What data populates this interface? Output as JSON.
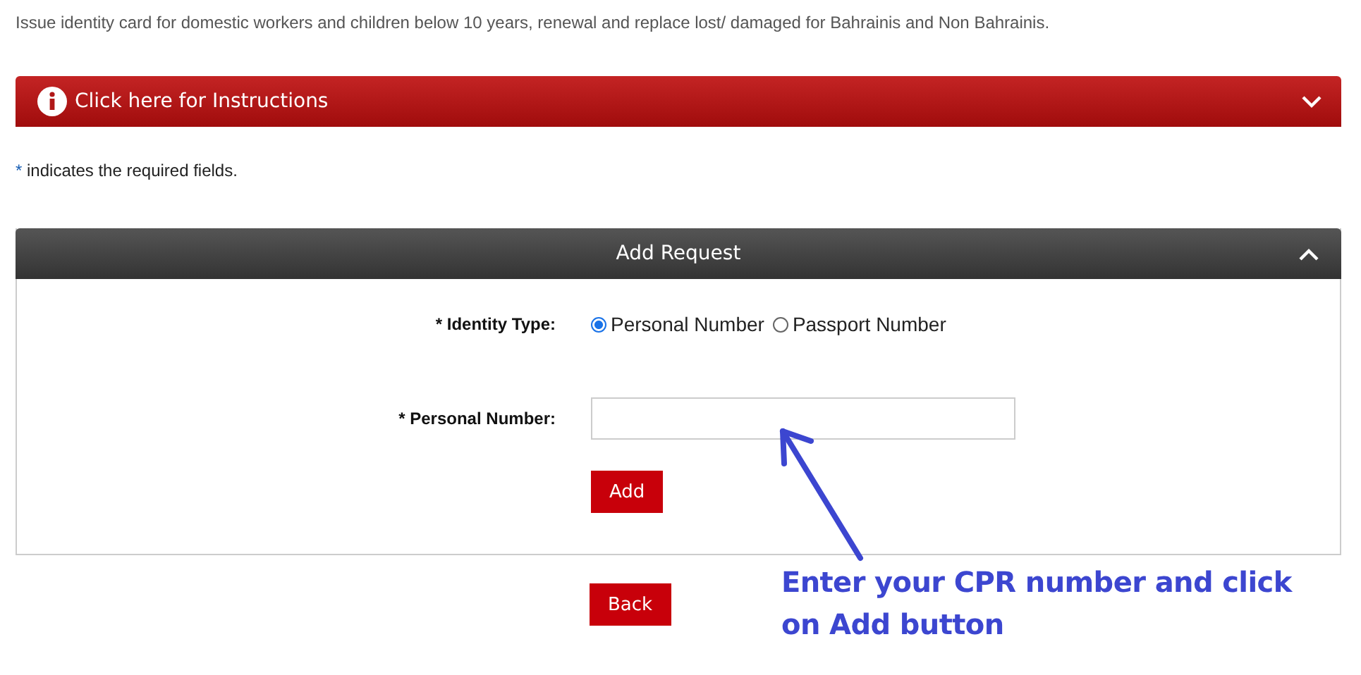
{
  "description": "Issue identity card for domestic workers and children below 10 years, renewal and replace lost/ damaged for Bahrainis and Non Bahrainis.",
  "instructions": {
    "label": "Click here for Instructions",
    "expanded": false
  },
  "required_note": {
    "mark": "*",
    "text": "indicates the required fields."
  },
  "panel": {
    "title": "Add Request",
    "expanded": true
  },
  "identity_type": {
    "label": "* Identity Type:",
    "options": [
      {
        "label": "Personal Number",
        "selected": true
      },
      {
        "label": "Passport Number",
        "selected": false
      }
    ]
  },
  "personal_number": {
    "label": "* Personal Number:"
  },
  "add_button": "Add",
  "back_button": "Back",
  "annotation": "Enter your CPR number and click on Add button"
}
